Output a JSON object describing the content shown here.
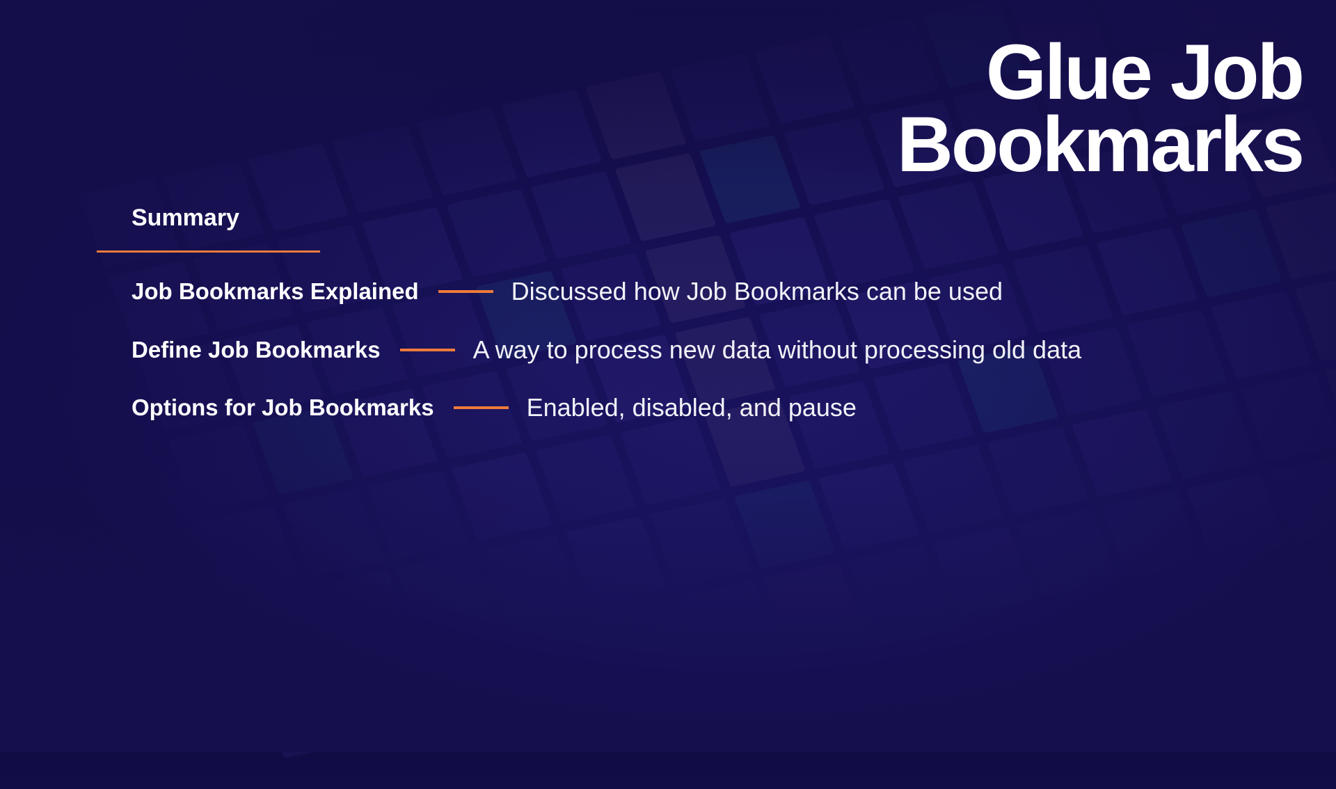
{
  "slide": {
    "title_line1": "Glue Job",
    "title_line2": "Bookmarks",
    "section_heading": "Summary",
    "accent_color": "#ef7b3a",
    "items": [
      {
        "label": "Job Bookmarks Explained",
        "description": "Discussed how Job Bookmarks can be used"
      },
      {
        "label": "Define Job Bookmarks",
        "description": "A way to process new data without processing old data"
      },
      {
        "label": "Options for Job Bookmarks",
        "description": "Enabled, disabled, and pause"
      }
    ]
  }
}
